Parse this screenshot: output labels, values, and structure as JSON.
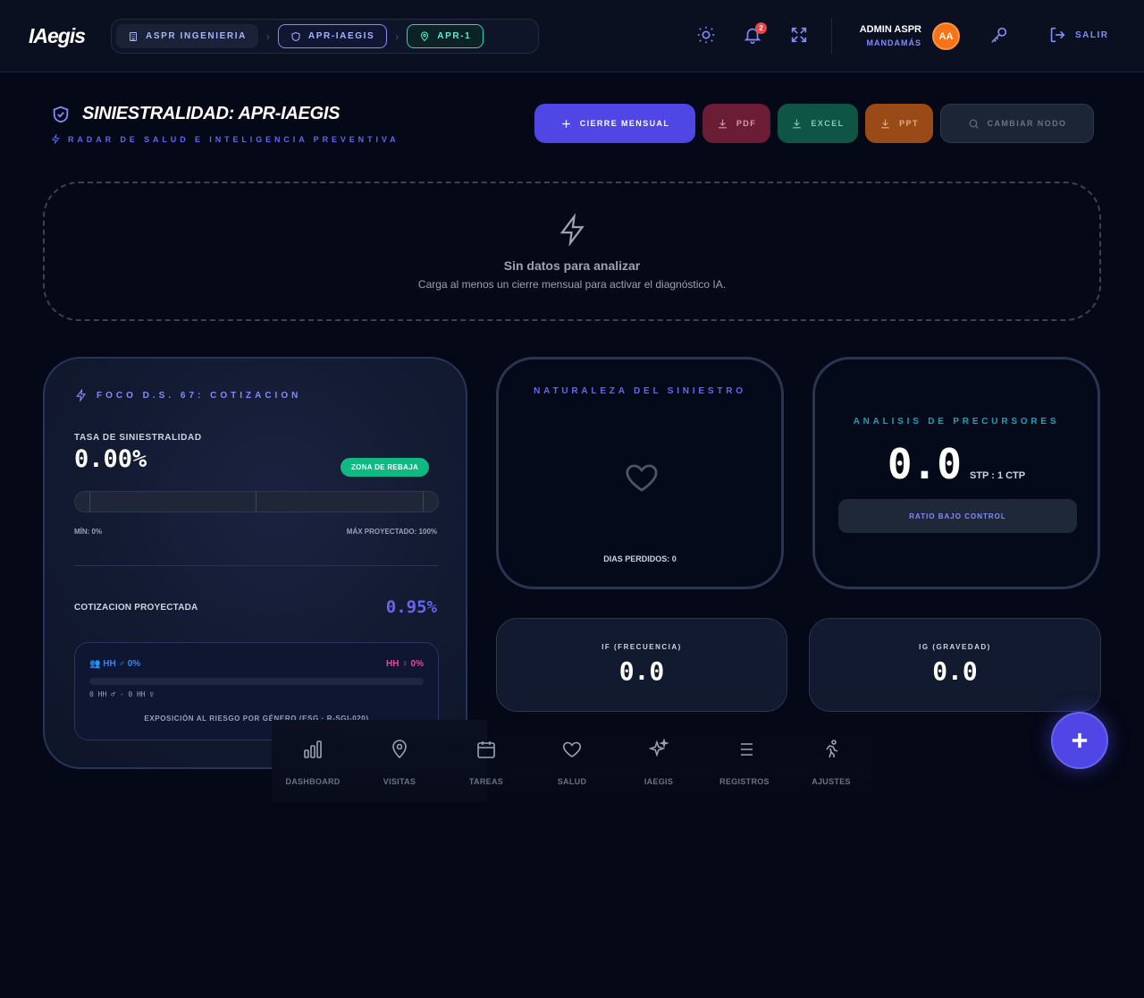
{
  "app": {
    "logo": "IAegis"
  },
  "breadcrumbs": [
    {
      "label": "ASPR INGENIERIA",
      "icon": "building-icon"
    },
    {
      "label": "APR-IAEGIS",
      "icon": "shield-icon"
    },
    {
      "label": "APR-1",
      "icon": "map-pin-icon"
    }
  ],
  "topbar": {
    "notifications_count": "2",
    "user_name": "ADMIN ASPR",
    "user_role": "MANDAMÁS",
    "avatar_initials": "AA",
    "logout_label": "SALIR"
  },
  "header": {
    "title": "SINIESTRALIDAD: APR-IAEGIS",
    "subtitle": "RADAR DE SALUD E INTELIGENCIA PREVENTIVA"
  },
  "actions": {
    "cierre": "CIERRE MENSUAL",
    "pdf": "PDF",
    "excel": "EXCEL",
    "ppt": "PPT",
    "cambiar_nodo": "CAMBIAR NODO"
  },
  "empty_state": {
    "title": "Sin datos para analizar",
    "description": "Carga al menos un cierre mensual para activar el diagnóstico IA."
  },
  "foco": {
    "title": "FOCO D.S. 67: COTIZACION",
    "tasa_label": "TASA DE SINIESTRALIDAD",
    "tasa_value": "0.00%",
    "zona_badge": "ZONA DE REBAJA",
    "gauge_level": 0,
    "gauge_min": "MÍN: 0%",
    "gauge_max": "MÁX PROYECTADO: 100%",
    "cotizacion_label": "COTIZACION PROYECTADA",
    "cotizacion_value": "0.95%",
    "genero": {
      "hh_male": "HH ♂ 0%",
      "hh_female": "HH ♀ 0%",
      "male_share": 0,
      "detail": "0 HH ♂ · 0 HH ♀",
      "caption": "EXPOSICIÓN AL RIESGO POR GÉNERO (ESG · R-SGI-020)"
    }
  },
  "naturaleza": {
    "title": "NATURALEZA DEL SINIESTRO",
    "dias_perdidos": "DIAS PERDIDOS: 0"
  },
  "precursores": {
    "title": "ANALISIS DE PRECURSORES",
    "value": "0.0",
    "unit": "STP : 1 CTP",
    "status": "RATIO BAJO CONTROL"
  },
  "indicadores": {
    "if_label": "IF (FRECUENCIA)",
    "if_value": "0.0",
    "ig_label": "IG (GRAVEDAD)",
    "ig_value": "0.0"
  },
  "bottom_nav": [
    {
      "label": "DASHBOARD",
      "icon": "bar-chart-icon"
    },
    {
      "label": "VISITAS",
      "icon": "map-pin-icon"
    },
    {
      "label": "TAREAS",
      "icon": "calendar-icon"
    },
    {
      "label": "SALUD",
      "icon": "heart-icon"
    },
    {
      "label": "IAEGIS",
      "icon": "sparkles-icon"
    },
    {
      "label": "REGISTROS",
      "icon": "list-icon"
    },
    {
      "label": "AJUSTES",
      "icon": "runner-icon"
    }
  ],
  "colors": {
    "accent": "#4f46e5",
    "success": "#10b981",
    "male": "#3b82f6",
    "female": "#ec4899"
  }
}
